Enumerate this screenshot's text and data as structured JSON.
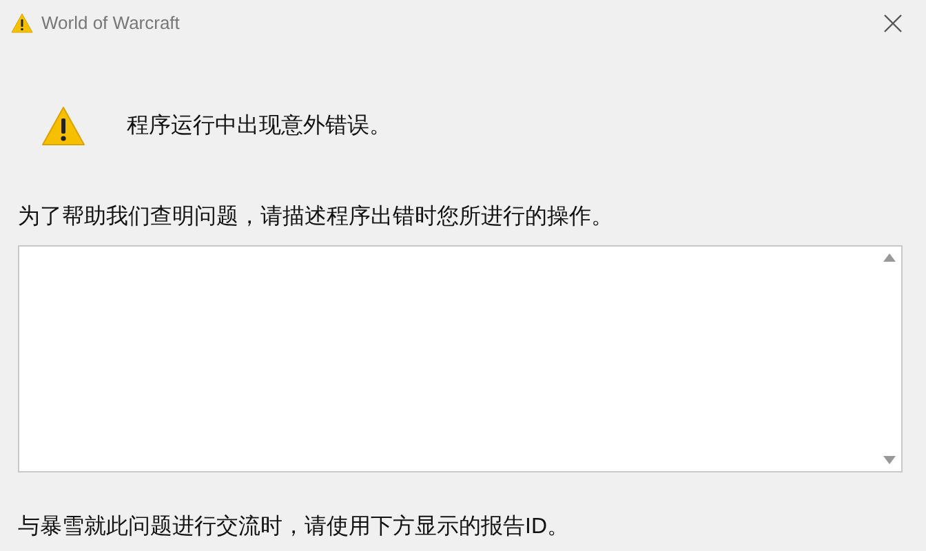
{
  "window": {
    "title": "World of Warcraft"
  },
  "message": "程序运行中出现意外错误。",
  "prompt": "为了帮助我们查明问题，请描述程序出错时您所进行的操作。",
  "footer_text": "与暴雪就此问题进行交流时，请使用下方显示的报告ID。"
}
